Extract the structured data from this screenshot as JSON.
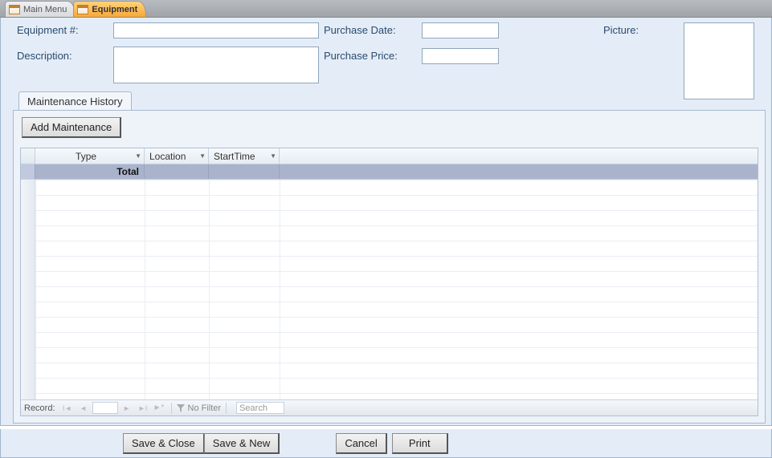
{
  "window_tabs": {
    "inactive": "Main Menu",
    "active": "Equipment"
  },
  "form": {
    "equipment_num_label": "Equipment #:",
    "equipment_num_value": "",
    "description_label": "Description:",
    "description_value": "",
    "purchase_date_label": "Purchase Date:",
    "purchase_date_value": "",
    "purchase_price_label": "Purchase Price:",
    "purchase_price_value": "",
    "picture_label": "Picture:"
  },
  "subtab": {
    "maintenance_history": "Maintenance History",
    "add_maintenance": "Add Maintenance"
  },
  "columns": {
    "type": "Type",
    "location": "Location",
    "starttime": "StartTime"
  },
  "total_row_label": "Total",
  "recordnav": {
    "label": "Record:",
    "current": "",
    "nofilter": "No Filter",
    "search": "Search"
  },
  "buttons": {
    "save_close": "Save & Close",
    "save_new": "Save & New",
    "cancel": "Cancel",
    "print": "Print"
  }
}
